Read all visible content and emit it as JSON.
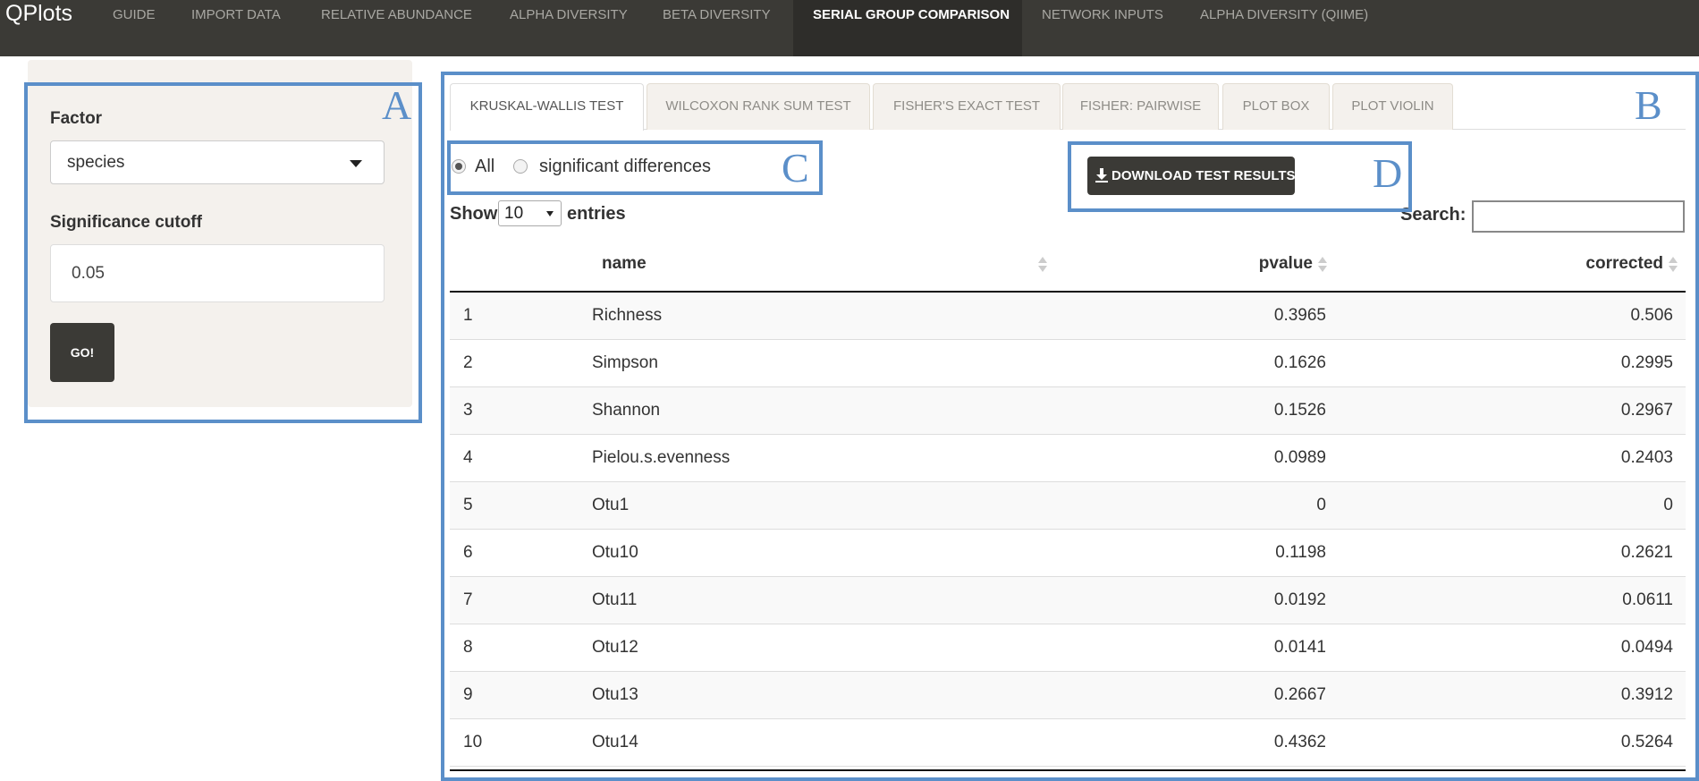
{
  "app": {
    "brand": "QPlots"
  },
  "nav": [
    {
      "label": "GUIDE",
      "active": false
    },
    {
      "label": "IMPORT DATA",
      "active": false
    },
    {
      "label": "RELATIVE ABUNDANCE",
      "active": false
    },
    {
      "label": "ALPHA DIVERSITY",
      "active": false
    },
    {
      "label": "BETA DIVERSITY",
      "active": false
    },
    {
      "label": "SERIAL GROUP COMPARISON",
      "active": true
    },
    {
      "label": "NETWORK INPUTS",
      "active": false
    },
    {
      "label": "ALPHA DIVERSITY (QIIME)",
      "active": false
    }
  ],
  "annotations": {
    "a": "A",
    "b": "B",
    "c": "C",
    "d": "D"
  },
  "sidebar": {
    "factor_label": "Factor",
    "factor_value": "species",
    "cutoff_label": "Significance cutoff",
    "cutoff_value": "0.05",
    "go_label": "GO!"
  },
  "tabs": [
    {
      "label": "KRUSKAL-WALLIS TEST",
      "active": true
    },
    {
      "label": "WILCOXON RANK SUM TEST",
      "active": false
    },
    {
      "label": "FISHER'S EXACT TEST",
      "active": false
    },
    {
      "label": "FISHER: PAIRWISE",
      "active": false
    },
    {
      "label": "PLOT BOX",
      "active": false
    },
    {
      "label": "PLOT VIOLIN",
      "active": false
    }
  ],
  "filter": {
    "options": [
      {
        "label": "All",
        "checked": true
      },
      {
        "label": "significant differences",
        "checked": false
      }
    ]
  },
  "download": {
    "label": "DOWNLOAD TEST RESULTS",
    "icon": "download-icon"
  },
  "table_controls": {
    "show_label": "Show",
    "length_value": "10",
    "entries_label": "entries",
    "search_label": "Search:",
    "search_value": ""
  },
  "table": {
    "columns": [
      "",
      "name",
      "pvalue",
      "corrected"
    ],
    "rows": [
      {
        "idx": "1",
        "name": "Richness",
        "pvalue": "0.3965",
        "corrected": "0.506"
      },
      {
        "idx": "2",
        "name": "Simpson",
        "pvalue": "0.1626",
        "corrected": "0.2995"
      },
      {
        "idx": "3",
        "name": "Shannon",
        "pvalue": "0.1526",
        "corrected": "0.2967"
      },
      {
        "idx": "4",
        "name": "Pielou.s.evenness",
        "pvalue": "0.0989",
        "corrected": "0.2403"
      },
      {
        "idx": "5",
        "name": "Otu1",
        "pvalue": "0",
        "corrected": "0"
      },
      {
        "idx": "6",
        "name": "Otu10",
        "pvalue": "0.1198",
        "corrected": "0.2621"
      },
      {
        "idx": "7",
        "name": "Otu11",
        "pvalue": "0.0192",
        "corrected": "0.0611"
      },
      {
        "idx": "8",
        "name": "Otu12",
        "pvalue": "0.0141",
        "corrected": "0.0494"
      },
      {
        "idx": "9",
        "name": "Otu13",
        "pvalue": "0.2667",
        "corrected": "0.3912"
      },
      {
        "idx": "10",
        "name": "Otu14",
        "pvalue": "0.4362",
        "corrected": "0.5264"
      }
    ]
  }
}
